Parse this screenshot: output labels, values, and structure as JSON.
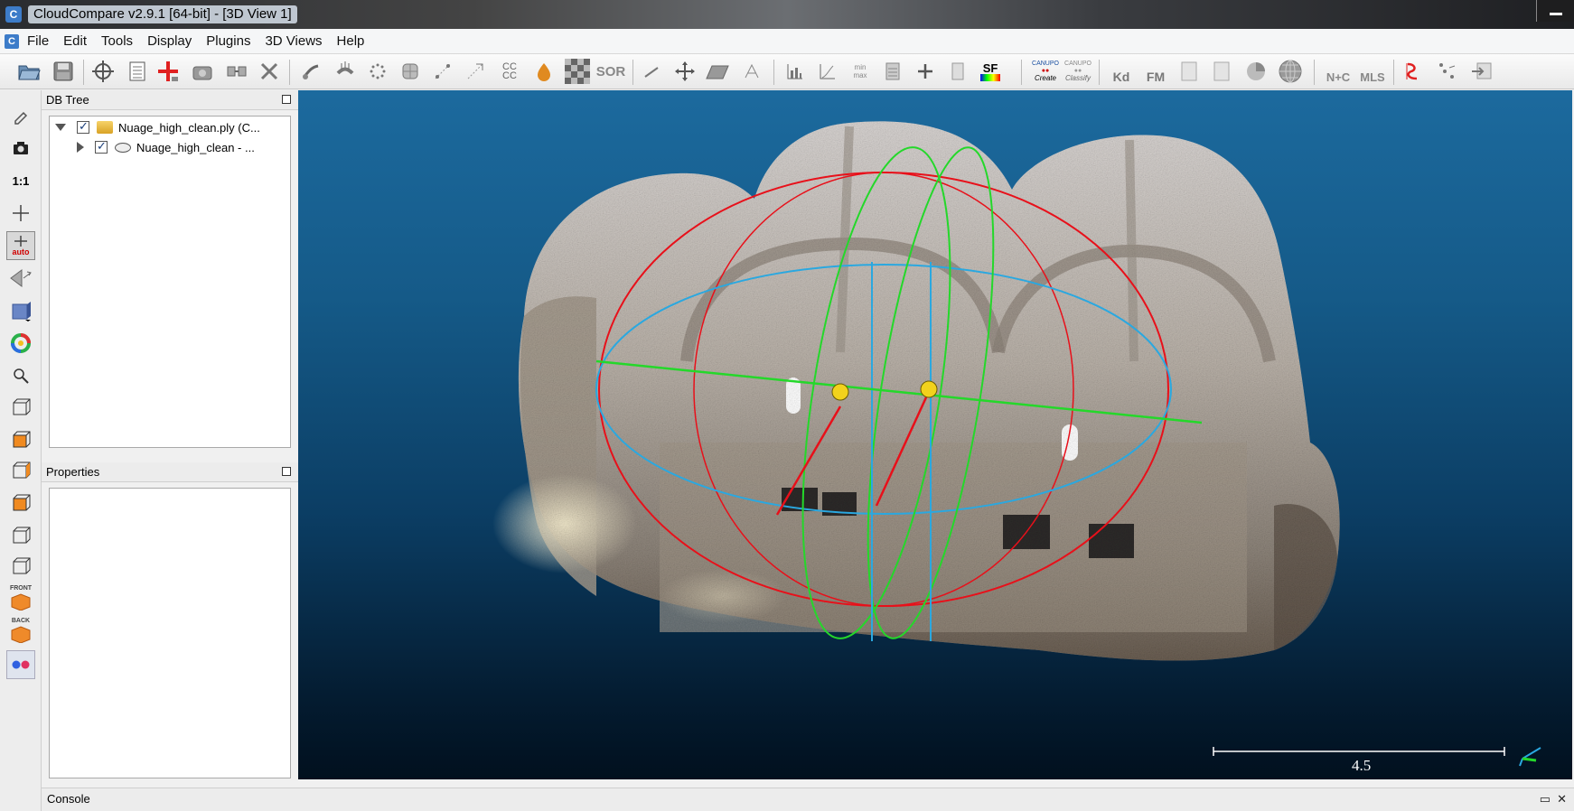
{
  "window": {
    "title": "CloudCompare v2.9.1 [64-bit] - [3D View 1]",
    "logo_letter": "C"
  },
  "menu": {
    "items": [
      "File",
      "Edit",
      "Tools",
      "Display",
      "Plugins",
      "3D Views",
      "Help"
    ]
  },
  "toolbar": {
    "labels": {
      "sor": "SOR",
      "sf": "SF",
      "canupo_create_top": "CANUPO",
      "canupo_create": "Create",
      "canupo_classify_top": "CANUPO",
      "canupo_classify": "Classify",
      "kd": "Kd",
      "fm": "FM",
      "nc": "N+C",
      "mls": "MLS",
      "min_max": "min max",
      "cc": "CC CC"
    }
  },
  "left_tools": {
    "scale_label": "1:1",
    "auto_label": "auto",
    "front_label": "FRONT",
    "back_label": "BACK"
  },
  "db_tree": {
    "title": "DB Tree",
    "items": [
      {
        "label": "Nuage_high_clean.ply (C...",
        "checked": true,
        "expanded": true
      },
      {
        "label": "Nuage_high_clean - ...",
        "checked": true,
        "expanded": false
      }
    ]
  },
  "properties": {
    "title": "Properties"
  },
  "view3d": {
    "scale_value": "4.5"
  },
  "console": {
    "title": "Console",
    "close_glyph": "✕"
  },
  "colors": {
    "view_bg_top": "#1c6a9e",
    "view_bg_bottom": "#01101e",
    "sphere_red": "#e8101a",
    "sphere_green": "#24d82a",
    "sphere_blue": "#2aa8e0"
  }
}
